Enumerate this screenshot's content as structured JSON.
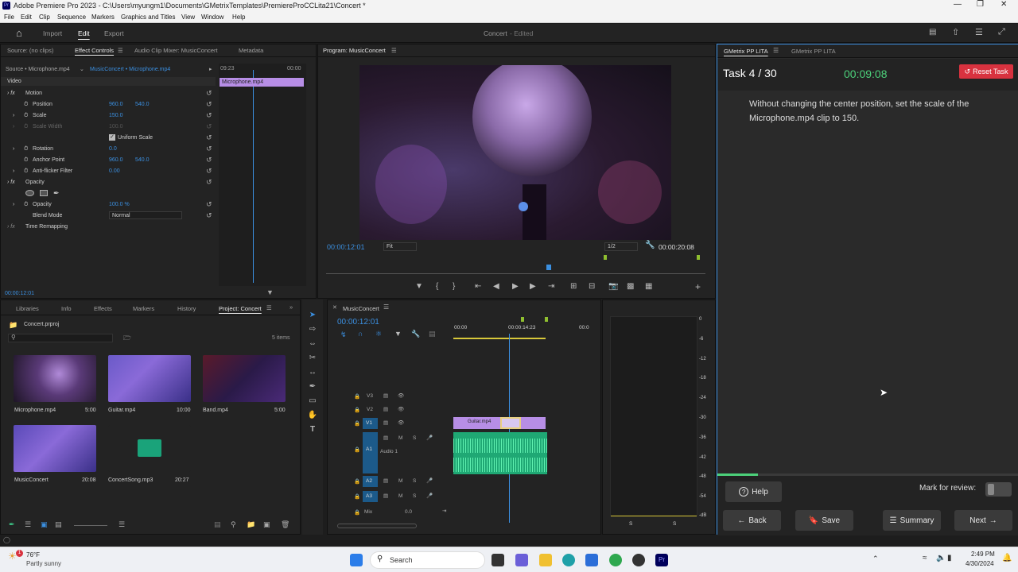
{
  "titlebar": {
    "title": "Adobe Premiere Pro 2023 - C:\\Users\\myungm1\\Documents\\GMetrixTemplates\\PremiereProCCLita21\\Concert *"
  },
  "menu": [
    "File",
    "Edit",
    "Clip",
    "Sequence",
    "Markers",
    "Graphics and Titles",
    "View",
    "Window",
    "Help"
  ],
  "appbar": {
    "import": "Import",
    "edit": "Edit",
    "export": "Export",
    "project": "Concert",
    "status": "- Edited"
  },
  "effect_controls": {
    "tabs": [
      "Source: (no clips)",
      "Effect Controls",
      "Audio Clip Mixer: MusicConcert",
      "Metadata"
    ],
    "source_label": "Source • Microphone.mp4",
    "clip_label": "MusicConcert • Microphone.mp4",
    "time_start": "09:23",
    "time_end": "00:00",
    "clip_name": "Microphone.mp4",
    "video": "Video",
    "motion": "Motion",
    "position": "Position",
    "position_x": "960.0",
    "position_y": "540.0",
    "scale": "Scale",
    "scale_v": "150.0",
    "scale_width": "Scale Width",
    "scale_width_v": "100.0",
    "uniform": "Uniform Scale",
    "rotation": "Rotation",
    "rotation_v": "0.0",
    "anchor": "Anchor Point",
    "anchor_x": "960.0",
    "anchor_y": "540.0",
    "antiflicker": "Anti-flicker Filter",
    "antiflicker_v": "0.00",
    "opacity_group": "Opacity",
    "opacity": "Opacity",
    "opacity_v": "100.0 %",
    "blend": "Blend Mode",
    "blend_v": "Normal",
    "time_remap": "Time Remapping",
    "timecode": "00:00:12:01"
  },
  "program": {
    "title": "Program: MusicConcert",
    "timecode": "00:00:12:01",
    "fit": "Fit",
    "res": "1/2",
    "duration": "00:00:20:08"
  },
  "project": {
    "tabs": [
      "Libraries",
      "Info",
      "Effects",
      "Markers",
      "History",
      "Project: Concert"
    ],
    "file": "Concert.prproj",
    "items": "5 items",
    "clips": [
      {
        "name": "Microphone.mp4",
        "dur": "5:00"
      },
      {
        "name": "Guitar.mp4",
        "dur": "10:00"
      },
      {
        "name": "Band.mp4",
        "dur": "5:00"
      },
      {
        "name": "MusicConcert",
        "dur": "20:08"
      },
      {
        "name": "ConcertSong.mp3",
        "dur": "20:27"
      }
    ]
  },
  "timeline": {
    "tab": "MusicConcert",
    "timecode": "00:00:12:01",
    "ruler": [
      "00:00",
      "00:00:14:23",
      "00:0"
    ],
    "tracks": [
      "V3",
      "V2",
      "V1",
      "A1",
      "A2",
      "A3"
    ],
    "audio_name": "Audio 1",
    "mix": "Mix",
    "mix_v": "0.0",
    "clip": "Guitar.mp4"
  },
  "meter": {
    "scale": [
      "0",
      "-6",
      "-12",
      "-18",
      "-24",
      "-30",
      "-36",
      "-42",
      "-48",
      "-54",
      "-dB"
    ],
    "s_labels": [
      "S",
      "S"
    ]
  },
  "gmetrix": {
    "tabs": [
      "GMetrix PP LITA",
      "GMetrix PP LITA"
    ],
    "task": "Task 4 / 30",
    "timer": "00:09:08",
    "reset": "Reset Task",
    "instruction": "Without changing the center position, set the scale of the Microphone.mp4 clip to 150.",
    "progress": 0.1333,
    "help": "Help",
    "mark": "Mark for review:",
    "back": "Back",
    "save": "Save",
    "summary": "Summary",
    "next": "Next"
  },
  "taskbar": {
    "temp": "76°F",
    "weather": "Partly sunny",
    "search": "Search",
    "time": "2:49 PM",
    "date": "4/30/2024"
  },
  "colors": {
    "accent": "#3b8fe0",
    "clip": "#b78ee6",
    "audio": "#3fd18d",
    "timer": "#4cd07a",
    "reset": "#d8323f"
  }
}
